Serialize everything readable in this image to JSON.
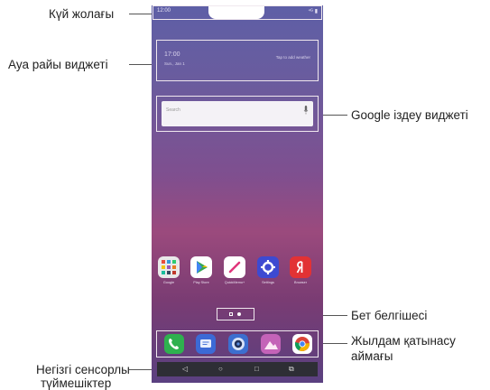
{
  "callouts": {
    "status_bar": "Күй жолағы",
    "weather_widget": "Ауа райы виджеті",
    "google_search_widget": "Google іздеу виджеті",
    "page_indicator": "Бет белгішесі",
    "quick_access_line1": "Жылдам қатынасу",
    "quick_access_line2": "аймағы",
    "home_touch_line1": "Негізгі сенсорлы",
    "home_touch_line2": "түймешіктер"
  },
  "phone": {
    "status_time": "12:00",
    "status_icons": "⁴ᴳ ▮",
    "weather_time": "17:00",
    "weather_date": "Sun., Jan 1",
    "weather_tap": "Tap to add weather",
    "search_placeholder": "Search",
    "apps": [
      {
        "label": "Google",
        "color": "#e9e9e9",
        "icon": "folder-icon"
      },
      {
        "label": "Play Store",
        "color": "#ffffff",
        "icon": "play-store-icon"
      },
      {
        "label": "QuickMemo+",
        "color": "#ffffff",
        "icon": "memo-icon"
      },
      {
        "label": "Settings",
        "color": "#3d4ad1",
        "icon": "gear-icon"
      },
      {
        "label": "Browser",
        "color": "#e23234",
        "icon": "yandex-icon"
      }
    ],
    "dock": [
      {
        "name": "phone",
        "color": "#2fb14f",
        "icon": "phone-icon"
      },
      {
        "name": "messages",
        "color": "#3c6ad6",
        "icon": "message-icon"
      },
      {
        "name": "camera",
        "color": "#3c6fcf",
        "icon": "camera-icon"
      },
      {
        "name": "gallery",
        "color": "#c463b8",
        "icon": "gallery-icon"
      },
      {
        "name": "chrome",
        "color": "#ffffff",
        "icon": "chrome-icon"
      }
    ],
    "nav": [
      {
        "glyph": "◁",
        "icon": "back-icon"
      },
      {
        "glyph": "○",
        "icon": "home-icon"
      },
      {
        "glyph": "□",
        "icon": "overview-icon"
      },
      {
        "glyph": "⧉",
        "icon": "dual-window-icon"
      }
    ]
  }
}
